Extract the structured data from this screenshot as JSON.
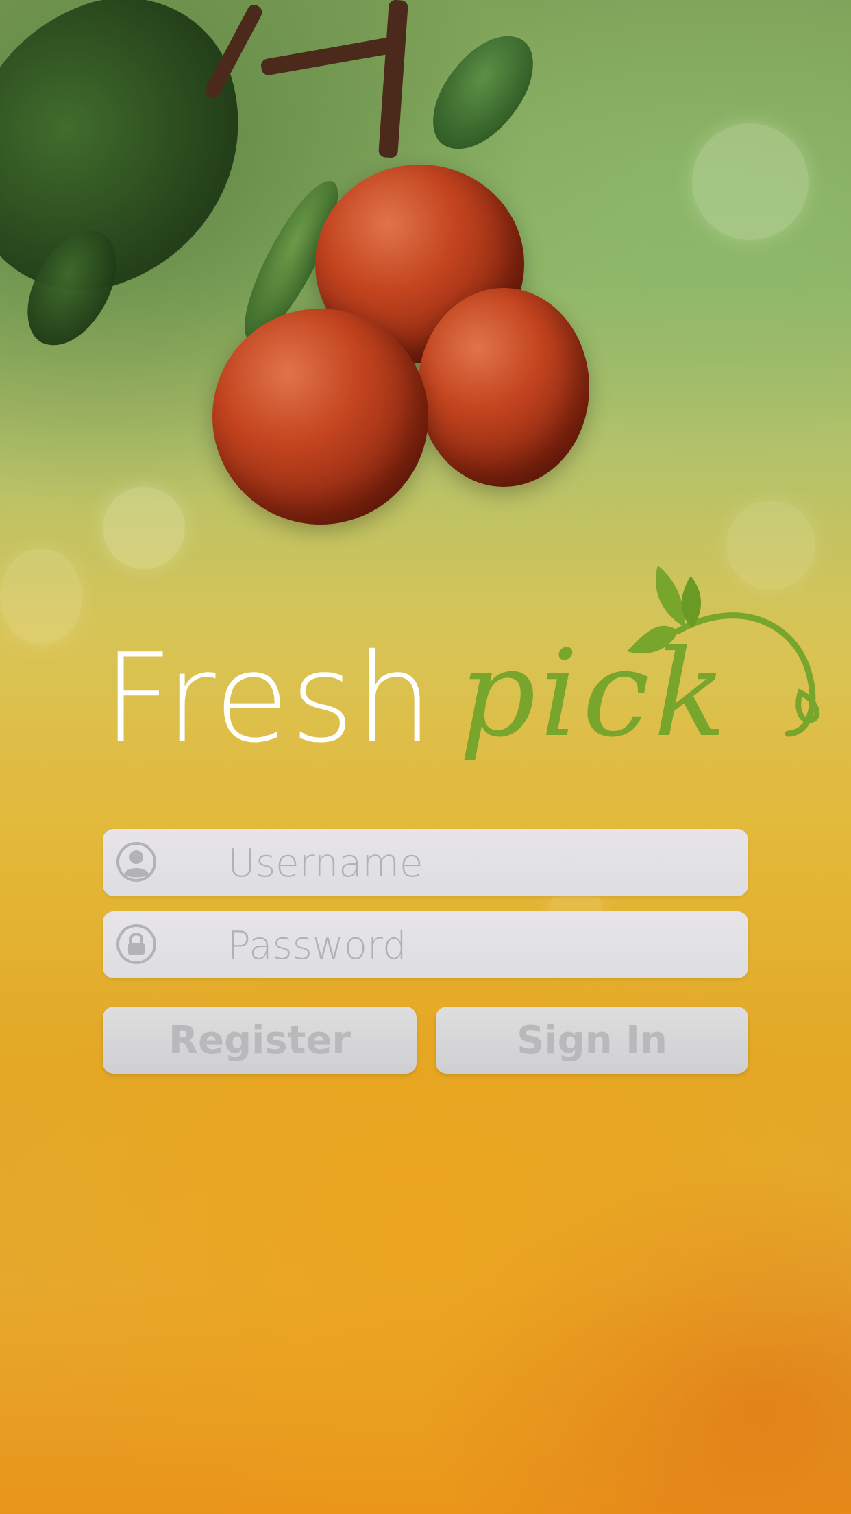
{
  "logo": {
    "word_fresh": "Fresh",
    "word_pick": "pick",
    "fresh_color": "#ffffff",
    "pick_color": "#78a52c"
  },
  "login": {
    "username_placeholder": "Username",
    "password_placeholder": "Password",
    "register_label": "Register",
    "signin_label": "Sign In",
    "username_icon": "user-circle-icon",
    "password_icon": "lock-circle-icon"
  },
  "theme": {
    "field_bg": "#e5e4e6",
    "button_bg": "#d8d8d9",
    "placeholder_color": "#b2b1b4"
  }
}
